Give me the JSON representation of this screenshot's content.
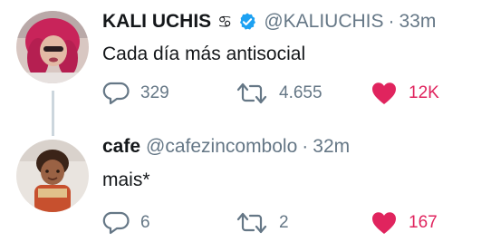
{
  "tweets": [
    {
      "name": "KALI UCHIS",
      "sign": "♋",
      "verified": true,
      "handle": "@KALIUCHIS",
      "separator": "·",
      "time": "33m",
      "text": "Cada día más antisocial",
      "replies": "329",
      "retweets": "4.655",
      "likes": "12K",
      "liked": true
    },
    {
      "name": "cafe",
      "handle": "@cafezincombolo",
      "separator": "·",
      "time": "32m",
      "text": "mais*",
      "replies": "6",
      "retweets": "2",
      "likes": "167",
      "liked": true
    }
  ],
  "colors": {
    "text": "#14171a",
    "secondary": "#657786",
    "like": "#e0245e",
    "verified": "#1da1f2",
    "thread_line": "#ccd6dd"
  },
  "icons": {
    "reply": "reply-icon",
    "retweet": "retweet-icon",
    "like": "heart-icon",
    "verified": "verified-badge-icon"
  }
}
